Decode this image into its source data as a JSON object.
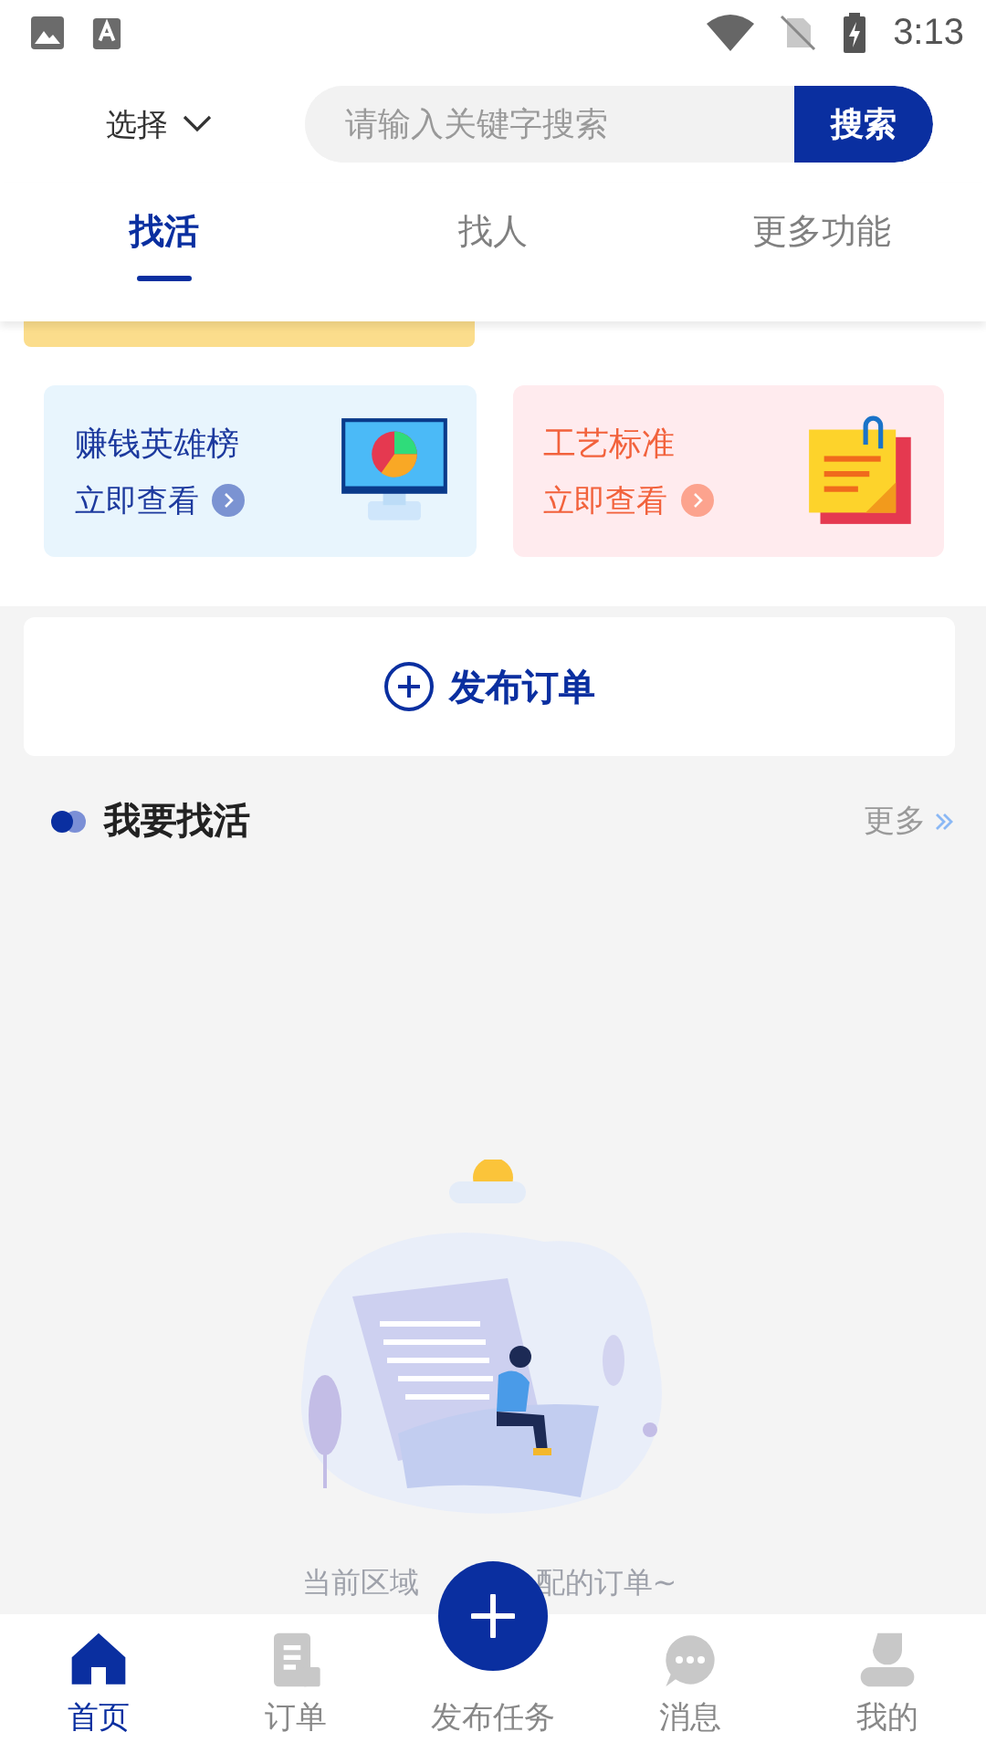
{
  "status_bar": {
    "time": "3:13"
  },
  "header": {
    "location_select": "选择",
    "search": {
      "placeholder": "请输入关键字搜索",
      "button": "搜索"
    }
  },
  "tabs": [
    {
      "label": "找活",
      "selected": true
    },
    {
      "label": "找人",
      "selected": false
    },
    {
      "label": "更多功能",
      "selected": false
    }
  ],
  "cards": [
    {
      "kind": "ranking",
      "title": "赚钱英雄榜",
      "link": "立即查看"
    },
    {
      "kind": "standard",
      "title": "工艺标准",
      "link": "立即查看"
    }
  ],
  "publish_button": "发布订单",
  "section": {
    "title": "我要找活",
    "more": "更多"
  },
  "empty_state": {
    "text_before": "当前区域",
    "text_after": "配的订单~"
  },
  "bottom_nav": [
    {
      "kind": "home",
      "label": "首页",
      "selected": true
    },
    {
      "kind": "orders",
      "label": "订单",
      "selected": false
    },
    {
      "kind": "publish",
      "label": "发布任务",
      "selected": false
    },
    {
      "kind": "messages",
      "label": "消息",
      "selected": false
    },
    {
      "kind": "profile",
      "label": "我的",
      "selected": false
    }
  ]
}
